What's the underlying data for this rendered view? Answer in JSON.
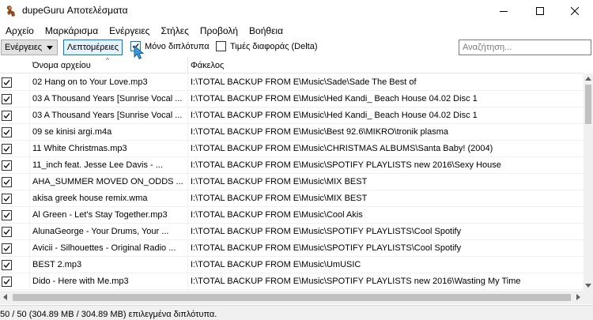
{
  "window": {
    "title": "dupeGuru Αποτελέσματα",
    "minimize_icon": "minimize-icon",
    "maximize_icon": "maximize-icon",
    "close_icon": "close-icon"
  },
  "menu": {
    "items": [
      "Αρχείο",
      "Μαρκάρισμα",
      "Ενέργειες",
      "Στήλες",
      "Προβολή",
      "Βοήθεια"
    ]
  },
  "toolbar": {
    "actions_label": "Ενέργειες",
    "details_label": "Λεπτομέρειες",
    "only_dupes_label": "Μόνο διπλότυπα",
    "only_dupes_checked": true,
    "delta_label": "Τιμές διαφοράς (Delta)",
    "delta_checked": false,
    "search_placeholder": "Αναζήτηση..."
  },
  "table": {
    "columns": [
      "Όνομα αρχείου",
      "Φάκελος"
    ],
    "sort_indicator": "^",
    "rows": [
      {
        "checked": true,
        "name": "02 Hang on to Your Love.mp3",
        "folder": "I:\\TOTAL BACKUP FROM E\\Music\\Sade\\Sade The Best of"
      },
      {
        "checked": true,
        "name": "03 A Thousand Years [Sunrise Vocal ...",
        "folder": "I:\\TOTAL BACKUP FROM E\\Music\\Hed Kandi_ Beach House 04.02 Disc 1"
      },
      {
        "checked": true,
        "name": "03 A Thousand Years [Sunrise Vocal ...",
        "folder": "I:\\TOTAL BACKUP FROM E\\Music\\Hed Kandi_ Beach House 04.02 Disc 1"
      },
      {
        "checked": true,
        "name": "09 se kinisi argi.m4a",
        "folder": "I:\\TOTAL BACKUP FROM E\\Music\\Best 92.6\\MIKRO\\tronik plasma"
      },
      {
        "checked": true,
        "name": "11 White Christmas.mp3",
        "folder": "I:\\TOTAL BACKUP FROM E\\Music\\CHRISTMAS ALBUMS\\Santa Baby! (2004)"
      },
      {
        "checked": true,
        "name": "11_inch feat. Jesse Lee Davis - ...",
        "folder": "I:\\TOTAL BACKUP FROM E\\Music\\SPOTIFY PLAYLISTS new 2016\\Sexy House"
      },
      {
        "checked": true,
        "name": "AHA_SUMMER MOVED ON_ODDS ...",
        "folder": "I:\\TOTAL BACKUP FROM E\\Music\\MIX BEST"
      },
      {
        "checked": true,
        "name": "akisa greek house remix.wma",
        "folder": "I:\\TOTAL BACKUP FROM E\\Music\\MIX BEST"
      },
      {
        "checked": true,
        "name": "Al Green - Let's Stay Together.mp3",
        "folder": "I:\\TOTAL BACKUP FROM E\\Music\\Cool Akis"
      },
      {
        "checked": true,
        "name": "AlunaGeorge - Your Drums, Your ...",
        "folder": "I:\\TOTAL BACKUP FROM E\\Music\\SPOTIFY PLAYLISTS\\Cool  Spotify"
      },
      {
        "checked": true,
        "name": "Avicii - Silhouettes - Original Radio ...",
        "folder": "I:\\TOTAL BACKUP FROM E\\Music\\SPOTIFY PLAYLISTS\\Cool  Spotify"
      },
      {
        "checked": true,
        "name": "BEST 2.mp3",
        "folder": "I:\\TOTAL BACKUP FROM E\\Music\\UmUSIC"
      },
      {
        "checked": true,
        "name": "Dido - Here with Me.mp3",
        "folder": "I:\\TOTAL BACKUP FROM E\\Music\\SPOTIFY PLAYLISTS new 2016\\Wasting My Time"
      }
    ]
  },
  "status": {
    "text": "50 / 50 (304.89 MB / 304.89 MB) επιλεγμένα διπλότυπα."
  },
  "colors": {
    "accent": "#0078d7",
    "app_icon_brown": "#8b4a1e"
  }
}
